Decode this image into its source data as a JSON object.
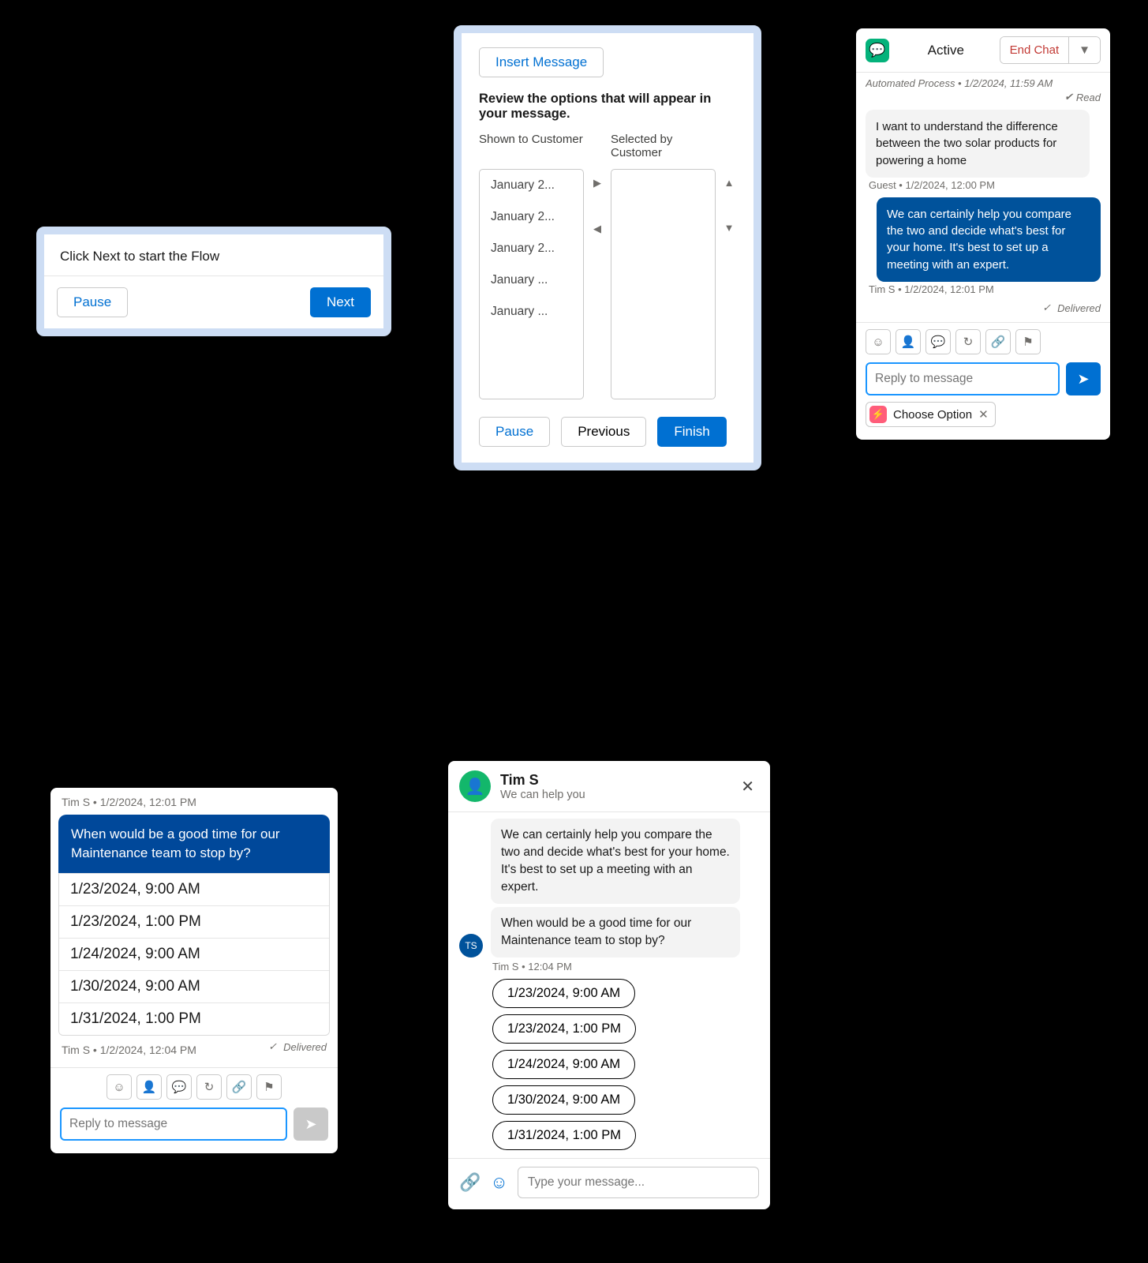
{
  "panel1": {
    "prompt": "Click Next to start the Flow",
    "pause": "Pause",
    "next": "Next"
  },
  "panel2": {
    "insert": "Insert Message",
    "title": "Review the options that will appear in your message.",
    "shown_label": "Shown to Customer",
    "selected_label": "Selected by Customer",
    "options": [
      "January 2...",
      "January 2...",
      "January 2...",
      "January ...",
      "January ..."
    ],
    "pause": "Pause",
    "previous": "Previous",
    "finish": "Finish"
  },
  "panel3": {
    "status": "Active",
    "end_chat": "End Chat",
    "top_meta": "Automated Process • 1/2/2024, 11:59 AM",
    "read": "Read",
    "guest_msg": "I want to understand the difference between the two solar products for powering a home",
    "guest_meta": "Guest • 1/2/2024, 12:00 PM",
    "agent_msg": "We can certainly help you compare the two and decide what's best for your home. It's best to set up a meeting with an expert.",
    "agent_meta": "Tim S • 1/2/2024, 12:01 PM",
    "delivered": "Delivered",
    "reply_placeholder": "Reply to message",
    "chip": "Choose Option"
  },
  "panel4": {
    "meta": "Tim S • 1/2/2024, 12:01 PM",
    "question": "When would be a good time for our Maintenance team to stop by?",
    "options": [
      "1/23/2024, 9:00 AM",
      "1/23/2024, 1:00 PM",
      "1/24/2024, 9:00 AM",
      "1/30/2024, 9:00 AM",
      "1/31/2024, 1:00 PM"
    ],
    "under_left": "Tim S • 1/2/2024, 12:04 PM",
    "delivered": "Delivered",
    "reply_placeholder": "Reply to message"
  },
  "panel5": {
    "name": "Tim S",
    "subtitle": "We can help you",
    "msg1": "We can certainly help you compare the two and decide what's best for your home. It's best to set up a meeting with an expert.",
    "msg2": "When would be a good time for our Maintenance team to stop by?",
    "stamp": "Tim S • 12:04 PM",
    "options": [
      "1/23/2024, 9:00 AM",
      "1/23/2024, 1:00 PM",
      "1/24/2024, 9:00 AM",
      "1/30/2024, 9:00 AM",
      "1/31/2024, 1:00 PM"
    ],
    "avatar_initials": "TS",
    "input_placeholder": "Type your message..."
  }
}
